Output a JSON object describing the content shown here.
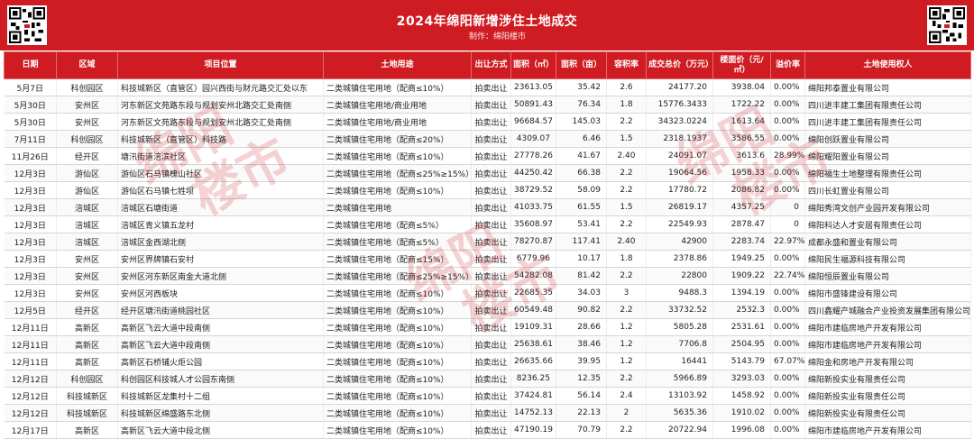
{
  "header": {
    "title": "2024年绵阳新增涉住土地成交",
    "credit": "制作：绵阳楼市"
  },
  "table": {
    "columns": [
      "日期",
      "区域",
      "项目位置",
      "土地用途",
      "出让方式",
      "面积（㎡）",
      "面积（亩）",
      "容积率",
      "成交总价（万元）",
      "楼面价（元/㎡）",
      "溢价率",
      "土地使用权人"
    ],
    "rows": [
      [
        "5月7日",
        "科创园区",
        "科技城新区（直管区）园兴西街与财元路交汇处以东",
        "二类城镇住宅用地（配商≤10%）",
        "拍卖出让",
        "23613.05",
        "35.42",
        "2.6",
        "24177.20",
        "3938.04",
        "0.00%",
        "绵阳邦泰置业有限公司"
      ],
      [
        "5月30日",
        "安州区",
        "河东新区文苑路东段与规划安州北路交汇处南侧",
        "二类城镇住宅用地/商业用地",
        "拍卖出让",
        "50891.43",
        "76.34",
        "1.8",
        "15776.3433",
        "1722.22",
        "0.00%",
        "四川进丰建工集团有限责任公司"
      ],
      [
        "5月30日",
        "安州区",
        "河东新区文苑路东段与规划安州北路交汇处南侧",
        "二类城镇住宅用地/商业用地",
        "拍卖出让",
        "96684.57",
        "145.03",
        "2.2",
        "34323.0224",
        "1613.64",
        "0.00%",
        "四川进丰建工集团有限责任公司"
      ],
      [
        "7月11日",
        "科创园区",
        "科技城新区（直管区）科技路",
        "二类城镇住宅用地（配商≤20%）",
        "拍卖出让",
        "4309.07",
        "6.46",
        "1.5",
        "2318.1937",
        "3586.55",
        "0.00%",
        "绵阳创跃置业有限公司"
      ],
      [
        "11月26日",
        "经开区",
        "塘汛街道涪滨社区",
        "二类城镇住宅用地（配商≤10%）",
        "拍卖出让",
        "27778.26",
        "41.67",
        "2.40",
        "24091.07",
        "3613.6",
        "28.99%",
        "绵阳耀阳置业有限公司"
      ],
      [
        "12月3日",
        "游仙区",
        "游仙区石马镇槐山社区",
        "二类城镇住宅用地（配商≤25%≥15%）",
        "拍卖出让",
        "44250.42",
        "66.38",
        "2.2",
        "19064.56",
        "1958.33",
        "0.00%",
        "绵阳福生土地整理有限责任公司"
      ],
      [
        "12月3日",
        "游仙区",
        "游仙区石马镇七姓坝",
        "二类城镇住宅用地（配商≤10%）",
        "拍卖出让",
        "38729.52",
        "58.09",
        "2.2",
        "17780.72",
        "2086.82",
        "0.00%",
        "四川长虹置业有限公司"
      ],
      [
        "12月3日",
        "涪城区",
        "涪城区石塘街道",
        "二类城镇住宅用地",
        "拍卖出让",
        "41033.75",
        "61.55",
        "1.5",
        "26819.17",
        "4357.25",
        "0",
        "绵阳秀湾文创产业园开发有限公司"
      ],
      [
        "12月3日",
        "涪城区",
        "涪城区青义镇五龙村",
        "二类城镇住宅用地（配商≤5%）",
        "拍卖出让",
        "35608.97",
        "53.41",
        "2.2",
        "22549.93",
        "2878.47",
        "0",
        "绵阳科达人才安居有限责任公司"
      ],
      [
        "12月3日",
        "涪城区",
        "涪城区金西湖北侧",
        "二类城镇住宅用地（配商≤5%）",
        "拍卖出让",
        "78270.87",
        "117.41",
        "2.40",
        "42900",
        "2283.74",
        "22.97%",
        "成都永盛和置业有限公司"
      ],
      [
        "12月3日",
        "安州区",
        "安州区界牌镇石安村",
        "二类城镇住宅用地（配商≤15%）",
        "拍卖出让",
        "6779.96",
        "10.17",
        "1.8",
        "2378.86",
        "1949.25",
        "0.00%",
        "绵阳民生福源科技有限公司"
      ],
      [
        "12月3日",
        "安州区",
        "安州区河东新区南金大道北侧",
        "二类城镇住宅用地（配商≤25%≥15%）",
        "拍卖出让",
        "54282.08",
        "81.42",
        "2.2",
        "22800",
        "1909.22",
        "22.74%",
        "绵阳恒辰置业有限公司"
      ],
      [
        "12月3日",
        "安州区",
        "安州区河西板块",
        "二类城镇住宅用地（配商≤10%）",
        "拍卖出让",
        "22685.35",
        "34.03",
        "3",
        "9488.3",
        "1394.19",
        "0.00%",
        "绵阳市盛锋建设有限公司"
      ],
      [
        "12月5日",
        "经开区",
        "经开区塘汛街道桃园社区",
        "二类城镇住宅用地（配商≤10%）",
        "拍卖出让",
        "60549.48",
        "90.82",
        "2.2",
        "33732.52",
        "2532.3",
        "0.00%",
        "四川鑫耀产城融合产业投资发展集团有限公司"
      ],
      [
        "12月11日",
        "高新区",
        "高新区飞云大道中段南侧",
        "二类城镇住宅用地（配商≤10%）",
        "拍卖出让",
        "19109.31",
        "28.66",
        "1.2",
        "5805.28",
        "2531.61",
        "0.00%",
        "绵阳市建临房地产开发有限公司"
      ],
      [
        "12月11日",
        "高新区",
        "高新区飞云大道中段南侧",
        "二类城镇住宅用地（配商≤10%）",
        "拍卖出让",
        "25638.61",
        "38.46",
        "1.2",
        "7706.8",
        "2504.95",
        "0.00%",
        "绵阳市建临房地产开发有限公司"
      ],
      [
        "12月11日",
        "高新区",
        "高新区石桥铺火炬公园",
        "二类城镇住宅用地（配商≤10%）",
        "拍卖出让",
        "26635.66",
        "39.95",
        "1.2",
        "16441",
        "5143.79",
        "67.07%",
        "绵阳金和房地产开发有限公司"
      ],
      [
        "12月12日",
        "科创园区",
        "科创园区科技城人才公园东南侧",
        "二类城镇住宅用地（配商≤10%）",
        "拍卖出让",
        "8236.25",
        "12.35",
        "2.2",
        "5966.89",
        "3293.03",
        "0.00%",
        "绵阳新投实业有限责任公司"
      ],
      [
        "12月12日",
        "科技城新区",
        "科技城新区龙集村十二组",
        "二类城镇住宅用地（配商≤10%）",
        "拍卖出让",
        "37424.81",
        "56.14",
        "2.4",
        "13103.92",
        "1458.92",
        "0.00%",
        "绵阳新投实业有限责任公司"
      ],
      [
        "12月12日",
        "科技城新区",
        "科技城新区绵盛路东北侧",
        "二类城镇住宅用地（配商≤10%）",
        "拍卖出让",
        "14752.13",
        "22.13",
        "2",
        "5635.36",
        "1910.02",
        "0.00%",
        "绵阳新投实业有限责任公司"
      ],
      [
        "12月17日",
        "高新区",
        "高新区飞云大道中段北侧",
        "二类城镇住宅用地（配商≤10%）",
        "拍卖出让",
        "47190.19",
        "70.79",
        "2.2",
        "20722.94",
        "1996.08",
        "0.00%",
        "绵阳市建临房地产开发有限公司"
      ]
    ]
  },
  "watermark": {
    "line1": "绵阳",
    "line2": "楼市"
  },
  "icons": {
    "left_qr": "qr-code-icon",
    "right_qr": "qr-code-icon"
  },
  "colors": {
    "accent": "#cf1c22"
  }
}
